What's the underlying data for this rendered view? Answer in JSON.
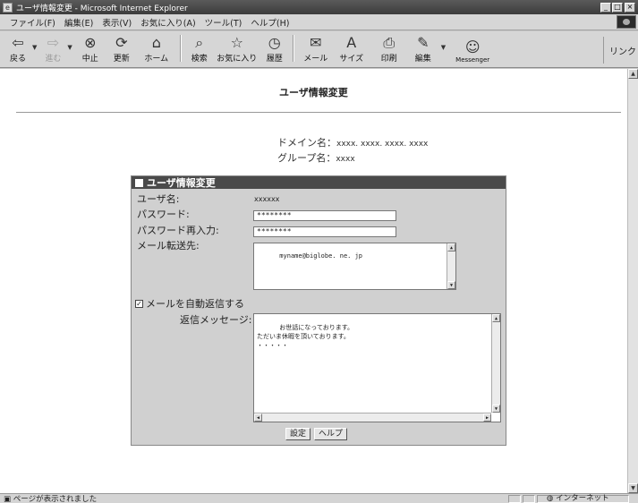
{
  "window": {
    "title": "ユーザ情報変更 - Microsoft Internet Explorer",
    "controls": {
      "minimize": "_",
      "maximize": "□",
      "close": "×"
    }
  },
  "menu": [
    "ファイル(F)",
    "編集(E)",
    "表示(V)",
    "お気に入り(A)",
    "ツール(T)",
    "ヘルプ(H)"
  ],
  "toolbar": {
    "back": "戻る",
    "forward": "進む",
    "stop": "中止",
    "refresh": "更新",
    "home": "ホーム",
    "search": "検索",
    "favorites": "お気に入り",
    "history": "履歴",
    "mail": "メール",
    "size": "サイズ",
    "print": "印刷",
    "edit": "編集",
    "messenger": "Messenger",
    "links": "リンク"
  },
  "page": {
    "title": "ユーザ情報変更",
    "domain_label": "ドメイン名：",
    "domain_value": "xxxx. xxxx. xxxx. xxxx",
    "group_label": "グループ名：",
    "group_value": "xxxx"
  },
  "form": {
    "header": "ユーザ情報変更",
    "username_label": "ユーザ名:",
    "username_value": "xxxxxx",
    "password_label": "パスワード:",
    "password_value": "********",
    "password_confirm_label": "パスワード再入力:",
    "password_confirm_value": "********",
    "forward_label": "メール転送先:",
    "forward_value": "myname@biglobe. ne. jp",
    "autoreply_label": "メールを自動返信する",
    "autoreply_checked": true,
    "reply_message_label": "返信メッセージ:",
    "reply_message_value": "お世話になっております。\nただいま休暇を頂いております。\n・・・・・",
    "submit_button": "設定",
    "help_button": "ヘルプ"
  },
  "status": {
    "text": "ページが表示されました",
    "zone": "インターネット"
  },
  "icons": {
    "browser": "ie-page-icon",
    "back": "back-arrow-icon",
    "forward": "forward-arrow-icon",
    "stop": "stop-icon",
    "refresh": "refresh-icon",
    "home": "home-icon",
    "search": "search-icon",
    "favorites": "favorites-icon",
    "history": "history-icon",
    "mail": "mail-icon",
    "size": "font-size-icon",
    "print": "printer-icon",
    "edit": "edit-icon",
    "messenger": "messenger-icon",
    "zone": "globe-icon"
  }
}
